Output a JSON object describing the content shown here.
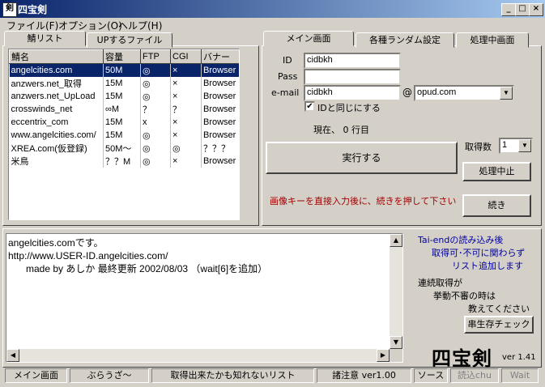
{
  "window": {
    "title": "四宝剣",
    "icon": "sword-icon"
  },
  "menu": [
    "ファイル(F)",
    "オプション(O)",
    "ヘルプ(H)"
  ],
  "left_tabs": [
    "鯖リスト",
    "UPするファイル"
  ],
  "table": {
    "headers": [
      "鯖名",
      "容量",
      "FTP",
      "CGI",
      "バナー"
    ],
    "rows": [
      [
        "angelcities.com",
        "50M",
        "◎",
        "×",
        "Browser"
      ],
      [
        "anzwers.net_取得",
        "15M",
        "◎",
        "×",
        "Browser"
      ],
      [
        "anzwers.net_UpLoad",
        "15M",
        "◎",
        "×",
        "Browser"
      ],
      [
        "crosswinds_net",
        "∞M",
        "？",
        "？",
        "Browser"
      ],
      [
        "eccentrix_com",
        "15M",
        "x",
        "×",
        "Browser"
      ],
      [
        "www.angelcities.com/",
        "15M",
        "◎",
        "×",
        "Browser"
      ],
      [
        "XREA.com(仮登録)",
        "50M～",
        "◎",
        "◎",
        "？？？"
      ],
      [
        "米鳥",
        "？？M",
        "◎",
        "×",
        "Browser"
      ]
    ]
  },
  "right_tabs": [
    "メイン画面",
    "各種ランダム設定",
    "処理中画面"
  ],
  "form": {
    "id_label": "ID",
    "id_value": "cidbkh",
    "pass_label": "Pass",
    "pass_value": "",
    "email_label": "e-mail",
    "email_value": "cidbkh",
    "at": "@",
    "domain_value": "opud.com",
    "same_id_label": "IDと同じにする",
    "status_line": "現在、 0 行目",
    "execute_button": "実行する",
    "count_label": "取得数",
    "count_value": "1",
    "stop_button": "処理中止",
    "hint": "画像キーを直接入力後に、続きを押して下さい",
    "continue_button": "続き"
  },
  "log": {
    "line1": "angelcities.comです。",
    "line2": "http://www.USER-ID.angelcities.com/",
    "line3": "made by あしか 最終更新 2002/08/03 （wait[6]を追加）"
  },
  "sidebar": {
    "note1_a": "Tai-endの読み込み後",
    "note1_b": "取得可･不可に関わらず",
    "note1_c": "リスト追加します",
    "note2_a": "連続取得が",
    "note2_b": "挙動不審の時は",
    "note2_c": "教えてください",
    "check_button": "串生存チェック",
    "logo": "四宝剣",
    "version": "ver 1.41"
  },
  "statusbar": [
    "メイン画面",
    "ぶらうざ～",
    "取得出来たかも知れないリスト",
    "諸注意 ver1.00",
    "ソース",
    "読込chu",
    "Wait"
  ]
}
